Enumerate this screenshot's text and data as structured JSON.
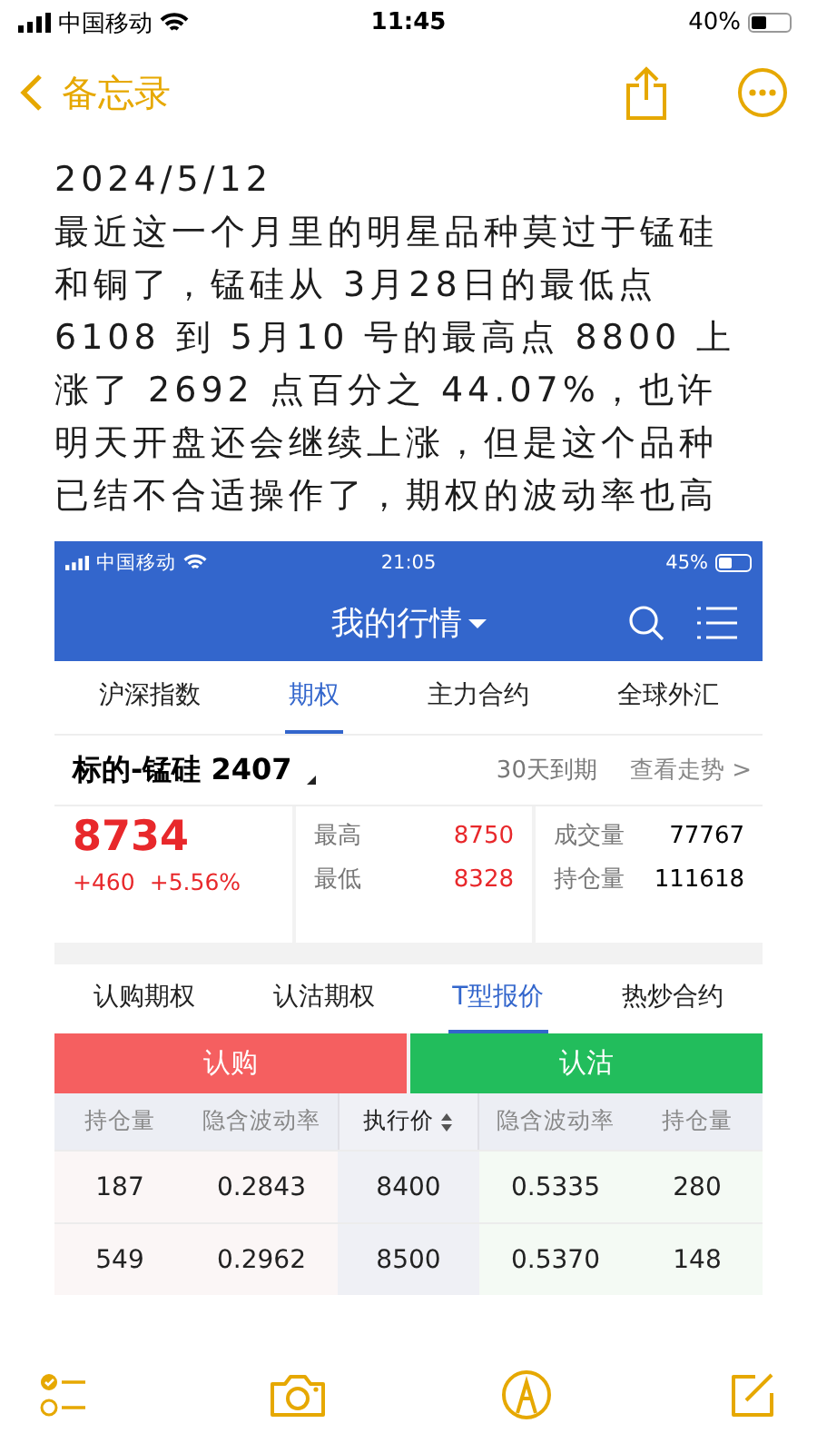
{
  "status_bar": {
    "carrier": "中国移动",
    "time": "11:45",
    "battery": "40%"
  },
  "nav": {
    "back_label": "备忘录"
  },
  "note": {
    "date": "2024/5/12",
    "body": "最近这一个月里的明星品种莫过于锰硅和铜了，锰硅从 3月28日的最低点 6108 到 5月10 号的最高点 8800 上涨了 2692 点百分之 44.07%，也许明天开盘还会继续上涨，但是这个品种已结不合适操作了，期权的波动率也高"
  },
  "embedded": {
    "status_bar": {
      "carrier": "中国移动",
      "time": "21:05",
      "battery": "45%"
    },
    "title": "我的行情",
    "tabs": [
      {
        "label": "沪深指数",
        "selected": false
      },
      {
        "label": "期权",
        "selected": true
      },
      {
        "label": "主力合约",
        "selected": false
      },
      {
        "label": "全球外汇",
        "selected": false
      }
    ],
    "underlying": {
      "name": "标的-锰硅 2407",
      "expiry": "30天到期",
      "trend_link": "查看走势 >"
    },
    "quote": {
      "price": "8734",
      "change": "+460",
      "change_pct": "+5.56%",
      "high_label": "最高",
      "high": "8750",
      "low_label": "最低",
      "low": "8328",
      "volume_label": "成交量",
      "volume": "77767",
      "oi_label": "持仓量",
      "oi": "111618"
    },
    "sub_tabs": [
      {
        "label": "认购期权",
        "selected": false
      },
      {
        "label": "认沽期权",
        "selected": false
      },
      {
        "label": "T型报价",
        "selected": true
      },
      {
        "label": "热炒合约",
        "selected": false
      }
    ],
    "call_label": "认购",
    "put_label": "认沽",
    "columns": [
      "持仓量",
      "隐含波动率",
      "执行价",
      "隐含波动率",
      "持仓量"
    ],
    "rows": [
      [
        "187",
        "0.2843",
        "8400",
        "0.5335",
        "280"
      ],
      [
        "549",
        "0.2962",
        "8500",
        "0.5370",
        "148"
      ]
    ]
  }
}
